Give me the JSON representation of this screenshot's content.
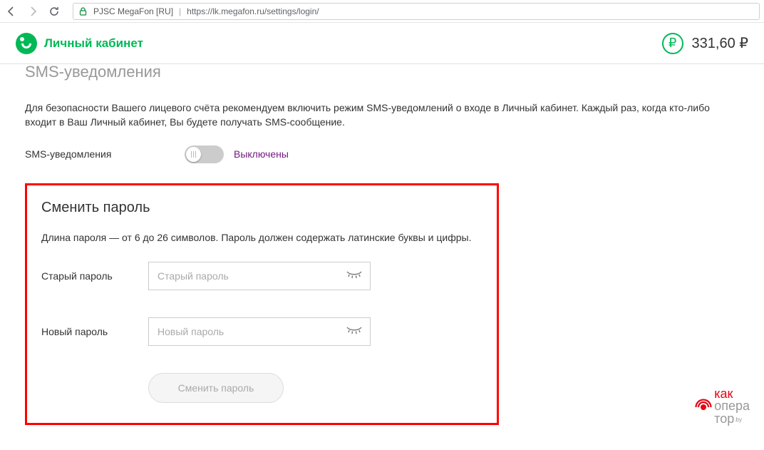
{
  "browser": {
    "cert_name": "PJSC MegaFon [RU]",
    "url": "https://lk.megafon.ru/settings/login/"
  },
  "header": {
    "logo_label": "Личный кабинет",
    "balance": "331,60 ₽"
  },
  "sms": {
    "section_title": "SMS-уведомления",
    "info": "Для безопасности Вашего лицевого счёта рекомендуем включить режим SMS-уведомлений о входе в Личный кабинет. Каждый раз, когда кто-либо входит в Ваш Личный кабинет, Вы будете получать SMS-сообщение.",
    "label": "SMS-уведомления",
    "status": "Выключены"
  },
  "password": {
    "title": "Сменить пароль",
    "info": "Длина пароля — от 6 до 26 символов. Пароль должен содержать латинские буквы и цифры.",
    "old_label": "Старый пароль",
    "old_placeholder": "Старый пароль",
    "new_label": "Новый пароль",
    "new_placeholder": "Новый пароль",
    "submit_label": "Сменить пароль"
  },
  "watermark": {
    "line1": "как",
    "line2": "опера",
    "line3": "тор",
    "suffix": ".by"
  }
}
